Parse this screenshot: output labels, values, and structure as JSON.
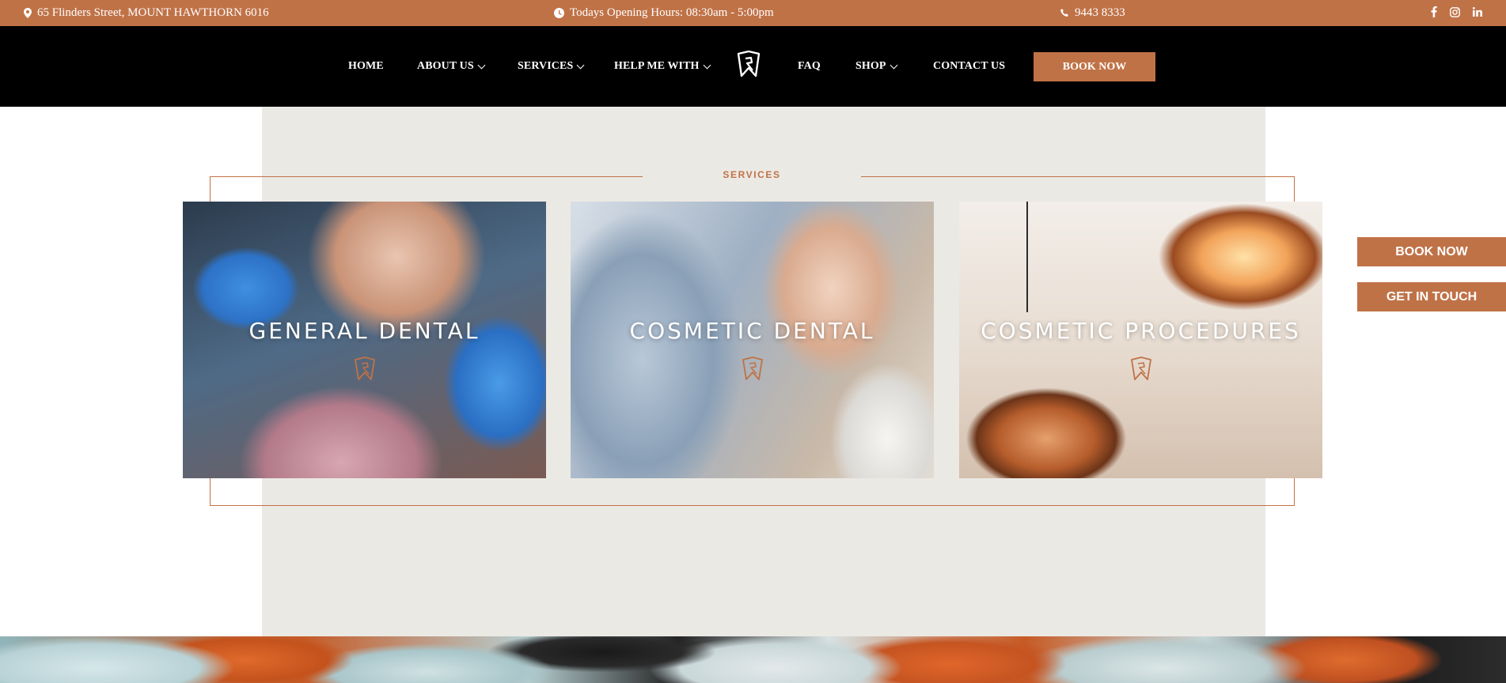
{
  "topbar": {
    "address": "65 Flinders Street, MOUNT HAWTHORN 6016",
    "hours": "Todays Opening Hours: 08:30am - 5:00pm",
    "phone": "9443 8333",
    "social": [
      "facebook-icon",
      "instagram-icon",
      "linkedin-icon"
    ]
  },
  "nav": {
    "items": [
      {
        "label": "HOME"
      },
      {
        "label": "ABOUT US"
      },
      {
        "label": "SERVICES"
      },
      {
        "label": "HELP ME WITH"
      },
      {
        "label": "FAQ"
      },
      {
        "label": "SHOP"
      },
      {
        "label": "CONTACT US"
      }
    ],
    "book_label": "BOOK NOW"
  },
  "services": {
    "heading": "SERVICES",
    "cards": [
      {
        "title": "GENERAL DENTAL"
      },
      {
        "title": "COSMETIC DENTAL"
      },
      {
        "title": "COSMETIC PROCEDURES"
      }
    ]
  },
  "side_buttons": {
    "book": "BOOK NOW",
    "contact": "GET IN TOUCH"
  },
  "colors": {
    "accent": "#c07247",
    "nav_bg": "#000000",
    "panel_bg": "#ebe9e4"
  }
}
